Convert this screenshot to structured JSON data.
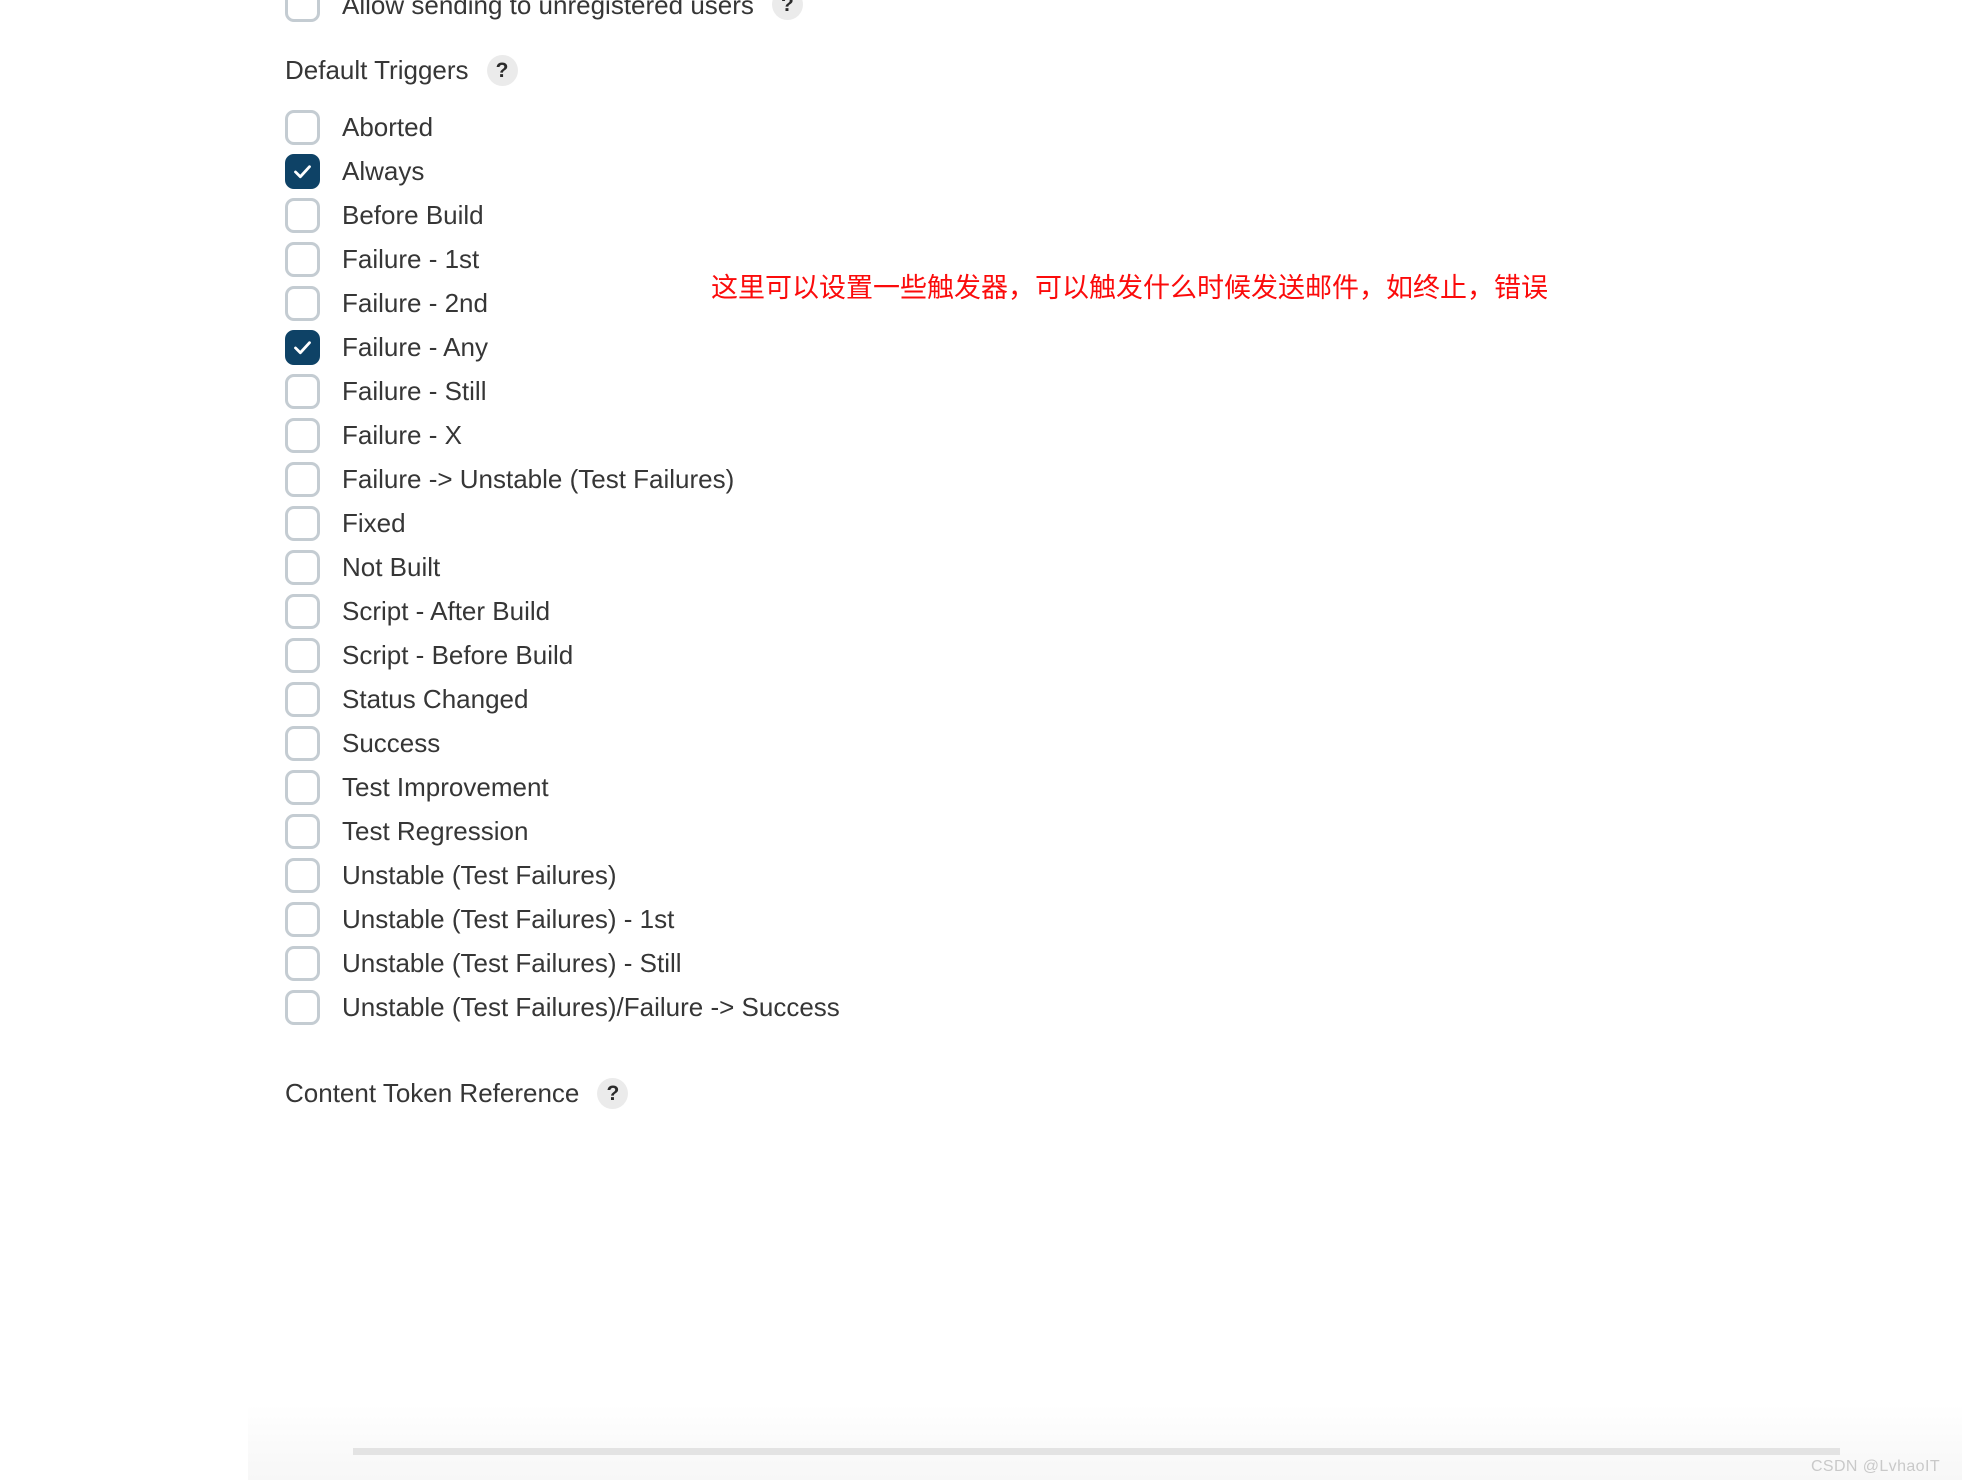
{
  "page": {
    "background_color": "#ffffff",
    "text_color": "#363636"
  },
  "top_partial_row": {
    "label": "Allow sending to unregistered users",
    "checked": false,
    "help_badge": "?"
  },
  "default_triggers": {
    "heading": "Default Triggers",
    "help_badge": "?",
    "checked_color": "#0e4266",
    "unchecked_border_color": "#c4ccd2",
    "items": [
      {
        "label": "Aborted",
        "checked": false
      },
      {
        "label": "Always",
        "checked": true
      },
      {
        "label": "Before Build",
        "checked": false
      },
      {
        "label": "Failure - 1st",
        "checked": false
      },
      {
        "label": "Failure - 2nd",
        "checked": false
      },
      {
        "label": "Failure - Any",
        "checked": true
      },
      {
        "label": "Failure - Still",
        "checked": false
      },
      {
        "label": "Failure - X",
        "checked": false
      },
      {
        "label": "Failure -> Unstable (Test Failures)",
        "checked": false
      },
      {
        "label": "Fixed",
        "checked": false
      },
      {
        "label": "Not Built",
        "checked": false
      },
      {
        "label": "Script - After Build",
        "checked": false
      },
      {
        "label": "Script - Before Build",
        "checked": false
      },
      {
        "label": "Status Changed",
        "checked": false
      },
      {
        "label": "Success",
        "checked": false
      },
      {
        "label": "Test Improvement",
        "checked": false
      },
      {
        "label": "Test Regression",
        "checked": false
      },
      {
        "label": "Unstable (Test Failures)",
        "checked": false
      },
      {
        "label": "Unstable (Test Failures) - 1st",
        "checked": false
      },
      {
        "label": "Unstable (Test Failures) - Still",
        "checked": false
      },
      {
        "label": "Unstable (Test Failures)/Failure -> Success",
        "checked": false
      }
    ]
  },
  "content_token_reference": {
    "heading": "Content Token Reference",
    "help_badge": "?"
  },
  "annotation": {
    "text": "这里可以设置一些触发器，可以触发什么时候发送邮件，如终止，错误",
    "color": "#fb0b0b"
  },
  "watermark": {
    "text": "CSDN @LvhaoIT"
  }
}
